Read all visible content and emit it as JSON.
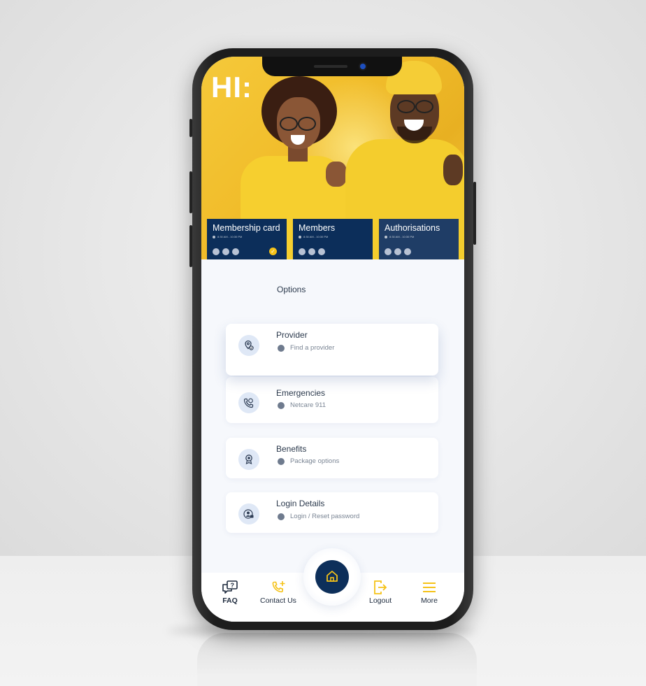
{
  "hero": {
    "greeting": "HI:"
  },
  "cards": [
    {
      "label": "Membership card",
      "time": "8:30 AM - 10:30 PM",
      "checked": true
    },
    {
      "label": "Members",
      "time": "8:30 AM - 10:30 PM",
      "checked": false
    },
    {
      "label": "Authorisations",
      "time": "8:30 AM - 10:30 PM",
      "checked": false
    }
  ],
  "options": {
    "title": "Options",
    "items": [
      {
        "title": "Provider",
        "subtitle": "Find a provider",
        "icon": "location-pin-icon"
      },
      {
        "title": "Emergencies",
        "subtitle": "Netcare 911",
        "icon": "phone-icon"
      },
      {
        "title": "Benefits",
        "subtitle": "Package options",
        "icon": "award-badge-icon"
      },
      {
        "title": "Login Details",
        "subtitle": "Login / Reset password",
        "icon": "user-lock-icon"
      }
    ]
  },
  "bottom_nav": {
    "faq": "FAQ",
    "contact": "Contact Us",
    "logout": "Logout",
    "more": "More"
  },
  "colors": {
    "navy": "#0c2e5a",
    "accent_yellow": "#f5c218",
    "hero_yellow": "#f1bd2b"
  }
}
